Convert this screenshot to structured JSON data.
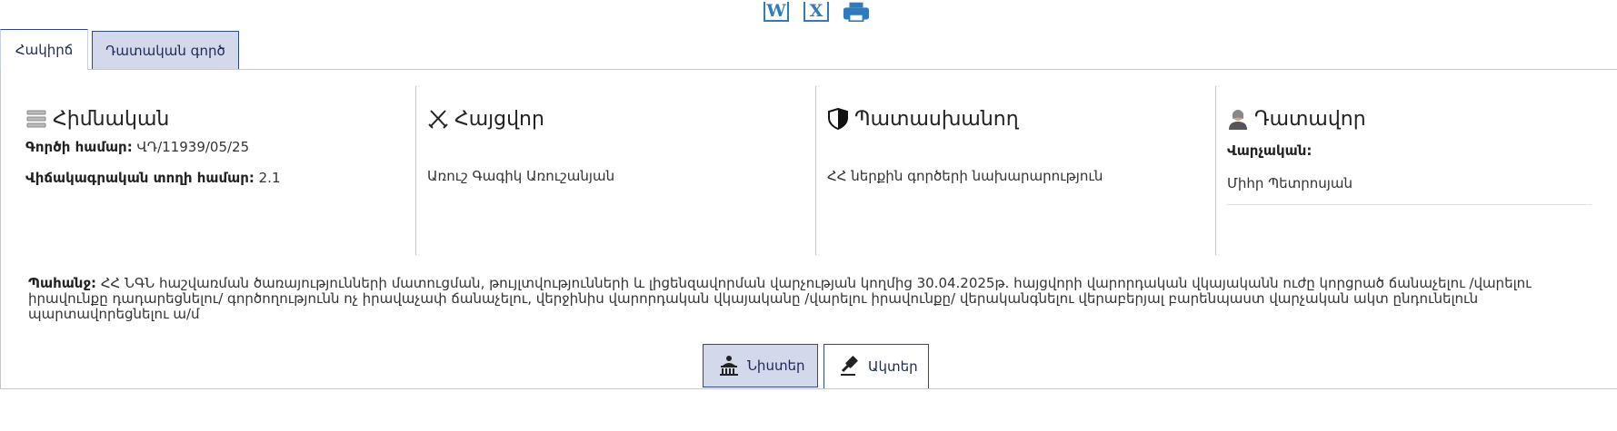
{
  "toolbar": {
    "word_icon": "word-icon",
    "word_glyph": "W",
    "excel_icon": "excel-icon",
    "excel_glyph": "X",
    "print_icon": "printer-icon",
    "accent_color": "#2e7bbf"
  },
  "tabs": [
    {
      "label": "Հակիրճ",
      "active": true
    },
    {
      "label": "Դատական գործ",
      "active": false
    }
  ],
  "columns": {
    "basic": {
      "title": "Հիմնական",
      "icon": "list-icon",
      "case_number_label": "Գործի համար:",
      "case_number_value": "ՎԴ/11939/05/25",
      "stat_row_label": "Վիճակագրական տողի համար:",
      "stat_row_value": "2.1"
    },
    "plaintiff": {
      "title": "Հայցվոր",
      "icon": "crossed-swords-icon",
      "name": "Առուշ Գագիկ Առուշանյան"
    },
    "defendant": {
      "title": "Պատասխանող",
      "icon": "shield-icon",
      "name": "ՀՀ ներքին գործերի նախարարություն"
    },
    "judge": {
      "title": "Դատավոր",
      "icon": "judge-avatar-icon",
      "section_label": "Վարչական:",
      "name": "Միհր Պետրոսյան"
    }
  },
  "claim": {
    "label": "Պահանջ:",
    "text": "ՀՀ ՆԳՆ հաշվառման ծառայությունների մատուցման, թույլտվությունների և լիցենզավորման վարչության կողմից 30.04.2025թ. հայցվորի վարորդական վկայականն ուժը կորցրած ճանաչելու /վարելու իրավունքը դադարեցնելու/ գործողությունն ոչ իրավաչափ ճանաչելու, վերջինիս վարորդական վկայականը /վարելու իրավունքը/ վերականգնելու վերաբերյալ բարենպաստ վարչական ակտ ընդունելուն պարտավորեցնելու ա/մ"
  },
  "bottom_tabs": [
    {
      "label": "Նիստեր",
      "icon": "courthouse-icon",
      "active": false
    },
    {
      "label": "Ակտեր",
      "icon": "gavel-icon",
      "active": true
    }
  ],
  "colors": {
    "tab_inactive_bg": "#d3d8ea",
    "tab_border": "#2c4a86"
  }
}
